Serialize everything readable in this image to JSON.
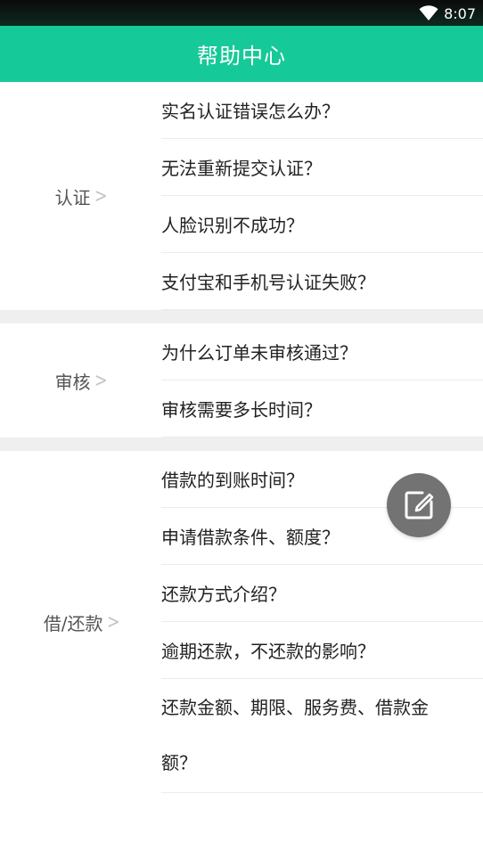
{
  "status_bar": {
    "time": "8:07",
    "wifi_icon": "wifi-icon"
  },
  "app_bar": {
    "title": "帮助中心"
  },
  "sections": [
    {
      "label": "认证",
      "items": [
        "实名认证错误怎么办？",
        "无法重新提交认证？",
        "人脸识别不成功？",
        "支付宝和手机号认证失败？"
      ]
    },
    {
      "label": "审核",
      "items": [
        "为什么订单未审核通过？",
        "审核需要多长时间？"
      ]
    },
    {
      "label": "借/还款",
      "items": [
        "借款的到账时间？",
        "申请借款条件、额度？",
        "还款方式介绍？",
        "逾期还款，不还款的影响？",
        "还款金额、期限、服务费、借款金额？"
      ]
    }
  ],
  "fab": {
    "icon": "edit-icon"
  },
  "colors": {
    "primary": "#16c998",
    "fab": "#737373",
    "divider": "#efefef"
  }
}
